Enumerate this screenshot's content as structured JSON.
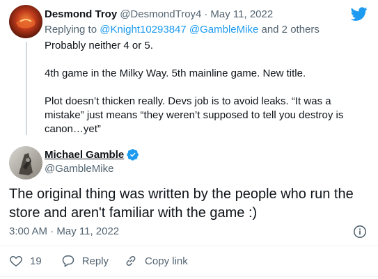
{
  "reply_tweet": {
    "display_name": "Desmond Troy",
    "handle": "@DesmondTroy4",
    "separator": "·",
    "date": "May 11, 2022",
    "replying_prefix": "Replying to",
    "replying_handles": "@Knight10293847 @GambleMike",
    "replying_suffix": "and 2 others",
    "paragraphs": [
      "Probably neither 4 or 5.",
      "4th game in the Milky Way. 5th mainline game. New title.",
      "Plot doesn’t thicken really. Devs job is to avoid leaks. “It was a mistake” just means “they weren’t supposed to tell you destroy is canon…yet”"
    ]
  },
  "main_tweet": {
    "display_name": "Michael Gamble",
    "handle": "@GambleMike",
    "verified_icon": "verified-badge-icon",
    "text": "The original thing was written by the people who run the store and aren't familiar with the game :)",
    "time": "3:00 AM · May 11, 2022",
    "info_icon": "info-icon",
    "actions": {
      "like_count": "19",
      "reply_label": "Reply",
      "copy_link_label": "Copy link"
    }
  },
  "colors": {
    "brand_blue": "#1d9bf0",
    "text_primary": "#0f1419",
    "text_secondary": "#536471",
    "divider": "#eff3f4"
  }
}
